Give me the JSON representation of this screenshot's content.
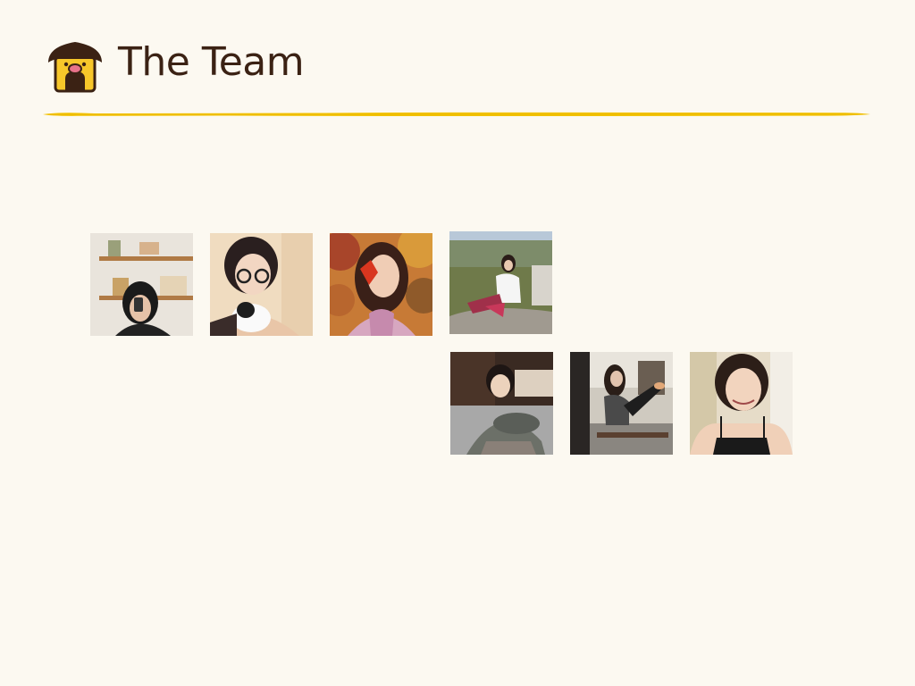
{
  "header": {
    "title": "The Team",
    "logo_icon": "doghouse-icon"
  },
  "colors": {
    "background": "#fcf9f1",
    "title": "#3b2214",
    "accent": "#f2c200",
    "logo_roof": "#3b2214",
    "logo_body": "#f7c72a",
    "logo_nose": "#e8728a"
  },
  "team": {
    "photos": [
      {
        "name": "team-photo-1"
      },
      {
        "name": "team-photo-2"
      },
      {
        "name": "team-photo-3"
      },
      {
        "name": "team-photo-4"
      },
      {
        "name": "team-photo-5"
      },
      {
        "name": "team-photo-6"
      },
      {
        "name": "team-photo-7"
      }
    ]
  }
}
